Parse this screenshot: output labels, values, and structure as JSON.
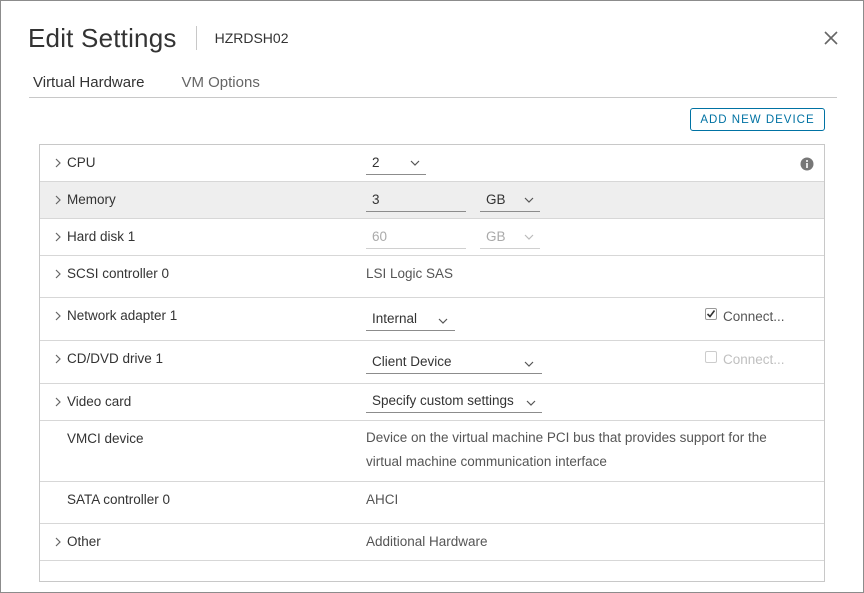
{
  "dialog": {
    "title": "Edit Settings",
    "vm_name": "HZRDSH02"
  },
  "tabs": [
    {
      "label": "Virtual Hardware"
    },
    {
      "label": "VM Options"
    }
  ],
  "add_device_label": "ADD NEW DEVICE",
  "rows": {
    "cpu": {
      "label": "CPU",
      "value": "2"
    },
    "memory": {
      "label": "Memory",
      "value": "3",
      "unit": "GB"
    },
    "hard_disk": {
      "label": "Hard disk 1",
      "value": "60",
      "unit": "GB"
    },
    "scsi": {
      "label": "SCSI controller 0",
      "value": "LSI Logic SAS"
    },
    "network": {
      "label": "Network adapter 1",
      "value": "Internal",
      "connect_label": "Connect...",
      "connected": true
    },
    "cddvd": {
      "label": "CD/DVD drive 1",
      "value": "Client Device",
      "connect_label": "Connect...",
      "connected": false
    },
    "video": {
      "label": "Video card",
      "value": "Specify custom settings"
    },
    "vmci": {
      "label": "VMCI device",
      "value": "Device on the virtual machine PCI bus that provides support for the virtual machine communication interface"
    },
    "sata": {
      "label": "SATA controller 0",
      "value": "AHCI"
    },
    "other": {
      "label": "Other",
      "value": "Additional Hardware"
    }
  },
  "colors": {
    "accent": "#0072a3",
    "row_highlight": "#eeeeee",
    "border": "#c8c8c8"
  },
  "icons": [
    "close-icon",
    "chevron-right-icon",
    "chevron-down-icon",
    "info-icon",
    "checkbox-icon"
  ]
}
